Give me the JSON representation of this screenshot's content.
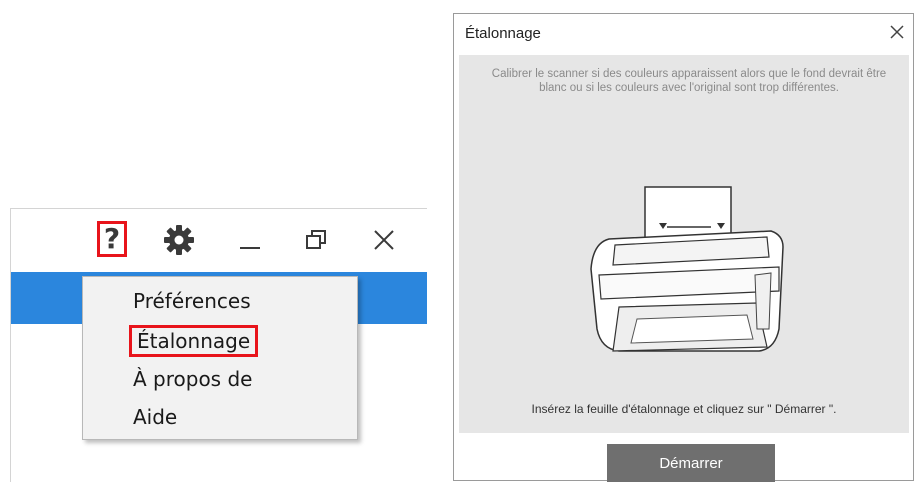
{
  "left_window": {
    "help_glyph": "?",
    "menu_items": [
      {
        "label": "Préférences"
      },
      {
        "label": "Étalonnage"
      },
      {
        "label": "À propos de"
      },
      {
        "label": "Aide"
      }
    ],
    "icons": {
      "help": "help-icon",
      "gear": "gear-icon",
      "minimize": "minimize-icon",
      "restore": "restore-icon",
      "close": "close-icon"
    },
    "colors": {
      "accent": "#2b86dd",
      "highlight": "#e8141b"
    }
  },
  "dialog": {
    "title": "Étalonnage",
    "description": "Calibrer le scanner si des couleurs apparaissent alors que le fond devrait être blanc ou si les couleurs avec l'original sont trop différentes.",
    "instruction": "Insérez la feuille d'étalonnage et cliquez sur \" Démarrer \".",
    "start_label": "Démarrer"
  }
}
